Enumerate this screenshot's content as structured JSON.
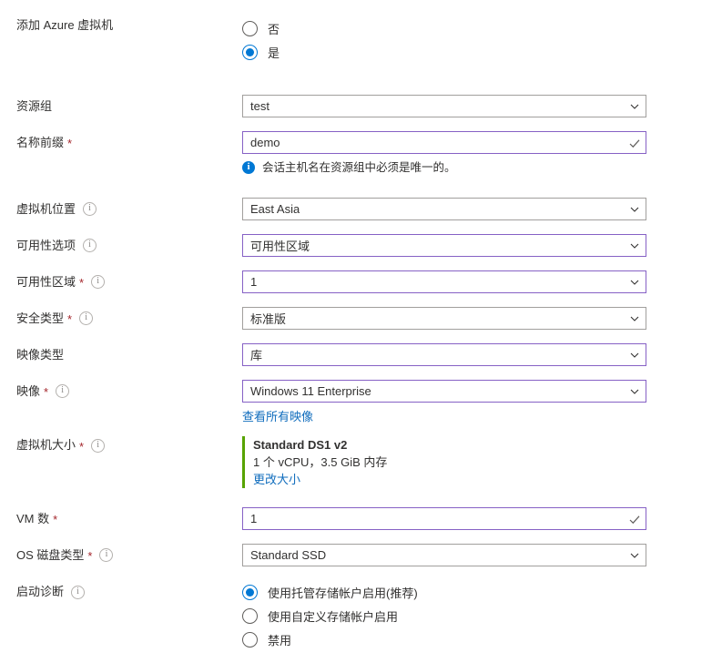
{
  "form": {
    "add_vm": {
      "label": "添加 Azure 虚拟机",
      "options": [
        {
          "label": "否",
          "selected": false
        },
        {
          "label": "是",
          "selected": true
        }
      ]
    },
    "resource_group": {
      "label": "资源组",
      "value": "test",
      "required": false,
      "has_info": false,
      "focused": false,
      "icon": "chevron-down-icon"
    },
    "name_prefix": {
      "label": "名称前缀",
      "value": "demo",
      "required": true,
      "has_info": false,
      "focused": true,
      "icon": "checkmark-icon",
      "note": "会话主机名在资源组中必须是唯一的。"
    },
    "vm_location": {
      "label": "虚拟机位置",
      "value": "East Asia",
      "required": false,
      "has_info": true,
      "focused": false,
      "icon": "chevron-down-icon"
    },
    "availability_option": {
      "label": "可用性选项",
      "value": "可用性区域",
      "required": false,
      "has_info": true,
      "focused": true,
      "icon": "chevron-down-icon"
    },
    "availability_zone": {
      "label": "可用性区域",
      "value": "1",
      "required": true,
      "has_info": true,
      "focused": true,
      "icon": "chevron-down-icon"
    },
    "security_type": {
      "label": "安全类型",
      "value": "标准版",
      "required": true,
      "has_info": true,
      "focused": false,
      "icon": "chevron-down-icon"
    },
    "image_type": {
      "label": "映像类型",
      "value": "库",
      "required": false,
      "has_info": false,
      "focused": true,
      "icon": "chevron-down-icon"
    },
    "image": {
      "label": "映像",
      "value": "Windows 11 Enterprise",
      "required": true,
      "has_info": true,
      "focused": true,
      "icon": "chevron-down-icon",
      "link": "查看所有映像"
    },
    "vm_size": {
      "label": "虚拟机大小",
      "required": true,
      "has_info": true,
      "size_name": "Standard DS1 v2",
      "size_specs": "1 个 vCPU，3.5 GiB 内存",
      "change_link": "更改大小",
      "accent_color": "#57a300"
    },
    "vm_count": {
      "label": "VM 数",
      "value": "1",
      "required": true,
      "has_info": false,
      "focused": true,
      "icon": "checkmark-icon"
    },
    "os_disk_type": {
      "label": "OS 磁盘类型",
      "value": "Standard SSD",
      "required": true,
      "has_info": true,
      "focused": false,
      "icon": "chevron-down-icon"
    },
    "boot_diagnostics": {
      "label": "启动诊断",
      "required": false,
      "has_info": true,
      "options": [
        {
          "label": "使用托管存储帐户启用(推荐)",
          "selected": true
        },
        {
          "label": "使用自定义存储帐户启用",
          "selected": false
        },
        {
          "label": "禁用",
          "selected": false
        }
      ]
    }
  },
  "colors": {
    "focus_border": "#8661c5",
    "default_border": "#a19f9d",
    "link": "#0f6cbd",
    "required_asterisk": "#a4262c",
    "radio_accent": "#0078d4",
    "info_blue": "#0078d4",
    "size_accent": "#57a300"
  }
}
